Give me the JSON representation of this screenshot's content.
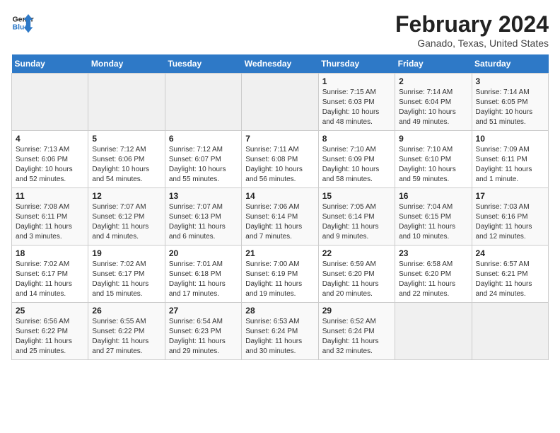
{
  "logo": {
    "line1": "General",
    "line2": "Blue"
  },
  "title": "February 2024",
  "subtitle": "Ganado, Texas, United States",
  "days_of_week": [
    "Sunday",
    "Monday",
    "Tuesday",
    "Wednesday",
    "Thursday",
    "Friday",
    "Saturday"
  ],
  "weeks": [
    [
      {
        "day": "",
        "info": ""
      },
      {
        "day": "",
        "info": ""
      },
      {
        "day": "",
        "info": ""
      },
      {
        "day": "",
        "info": ""
      },
      {
        "day": "1",
        "info": "Sunrise: 7:15 AM\nSunset: 6:03 PM\nDaylight: 10 hours\nand 48 minutes."
      },
      {
        "day": "2",
        "info": "Sunrise: 7:14 AM\nSunset: 6:04 PM\nDaylight: 10 hours\nand 49 minutes."
      },
      {
        "day": "3",
        "info": "Sunrise: 7:14 AM\nSunset: 6:05 PM\nDaylight: 10 hours\nand 51 minutes."
      }
    ],
    [
      {
        "day": "4",
        "info": "Sunrise: 7:13 AM\nSunset: 6:06 PM\nDaylight: 10 hours\nand 52 minutes."
      },
      {
        "day": "5",
        "info": "Sunrise: 7:12 AM\nSunset: 6:06 PM\nDaylight: 10 hours\nand 54 minutes."
      },
      {
        "day": "6",
        "info": "Sunrise: 7:12 AM\nSunset: 6:07 PM\nDaylight: 10 hours\nand 55 minutes."
      },
      {
        "day": "7",
        "info": "Sunrise: 7:11 AM\nSunset: 6:08 PM\nDaylight: 10 hours\nand 56 minutes."
      },
      {
        "day": "8",
        "info": "Sunrise: 7:10 AM\nSunset: 6:09 PM\nDaylight: 10 hours\nand 58 minutes."
      },
      {
        "day": "9",
        "info": "Sunrise: 7:10 AM\nSunset: 6:10 PM\nDaylight: 10 hours\nand 59 minutes."
      },
      {
        "day": "10",
        "info": "Sunrise: 7:09 AM\nSunset: 6:11 PM\nDaylight: 11 hours\nand 1 minute."
      }
    ],
    [
      {
        "day": "11",
        "info": "Sunrise: 7:08 AM\nSunset: 6:11 PM\nDaylight: 11 hours\nand 3 minutes."
      },
      {
        "day": "12",
        "info": "Sunrise: 7:07 AM\nSunset: 6:12 PM\nDaylight: 11 hours\nand 4 minutes."
      },
      {
        "day": "13",
        "info": "Sunrise: 7:07 AM\nSunset: 6:13 PM\nDaylight: 11 hours\nand 6 minutes."
      },
      {
        "day": "14",
        "info": "Sunrise: 7:06 AM\nSunset: 6:14 PM\nDaylight: 11 hours\nand 7 minutes."
      },
      {
        "day": "15",
        "info": "Sunrise: 7:05 AM\nSunset: 6:14 PM\nDaylight: 11 hours\nand 9 minutes."
      },
      {
        "day": "16",
        "info": "Sunrise: 7:04 AM\nSunset: 6:15 PM\nDaylight: 11 hours\nand 10 minutes."
      },
      {
        "day": "17",
        "info": "Sunrise: 7:03 AM\nSunset: 6:16 PM\nDaylight: 11 hours\nand 12 minutes."
      }
    ],
    [
      {
        "day": "18",
        "info": "Sunrise: 7:02 AM\nSunset: 6:17 PM\nDaylight: 11 hours\nand 14 minutes."
      },
      {
        "day": "19",
        "info": "Sunrise: 7:02 AM\nSunset: 6:17 PM\nDaylight: 11 hours\nand 15 minutes."
      },
      {
        "day": "20",
        "info": "Sunrise: 7:01 AM\nSunset: 6:18 PM\nDaylight: 11 hours\nand 17 minutes."
      },
      {
        "day": "21",
        "info": "Sunrise: 7:00 AM\nSunset: 6:19 PM\nDaylight: 11 hours\nand 19 minutes."
      },
      {
        "day": "22",
        "info": "Sunrise: 6:59 AM\nSunset: 6:20 PM\nDaylight: 11 hours\nand 20 minutes."
      },
      {
        "day": "23",
        "info": "Sunrise: 6:58 AM\nSunset: 6:20 PM\nDaylight: 11 hours\nand 22 minutes."
      },
      {
        "day": "24",
        "info": "Sunrise: 6:57 AM\nSunset: 6:21 PM\nDaylight: 11 hours\nand 24 minutes."
      }
    ],
    [
      {
        "day": "25",
        "info": "Sunrise: 6:56 AM\nSunset: 6:22 PM\nDaylight: 11 hours\nand 25 minutes."
      },
      {
        "day": "26",
        "info": "Sunrise: 6:55 AM\nSunset: 6:22 PM\nDaylight: 11 hours\nand 27 minutes."
      },
      {
        "day": "27",
        "info": "Sunrise: 6:54 AM\nSunset: 6:23 PM\nDaylight: 11 hours\nand 29 minutes."
      },
      {
        "day": "28",
        "info": "Sunrise: 6:53 AM\nSunset: 6:24 PM\nDaylight: 11 hours\nand 30 minutes."
      },
      {
        "day": "29",
        "info": "Sunrise: 6:52 AM\nSunset: 6:24 PM\nDaylight: 11 hours\nand 32 minutes."
      },
      {
        "day": "",
        "info": ""
      },
      {
        "day": "",
        "info": ""
      }
    ]
  ]
}
